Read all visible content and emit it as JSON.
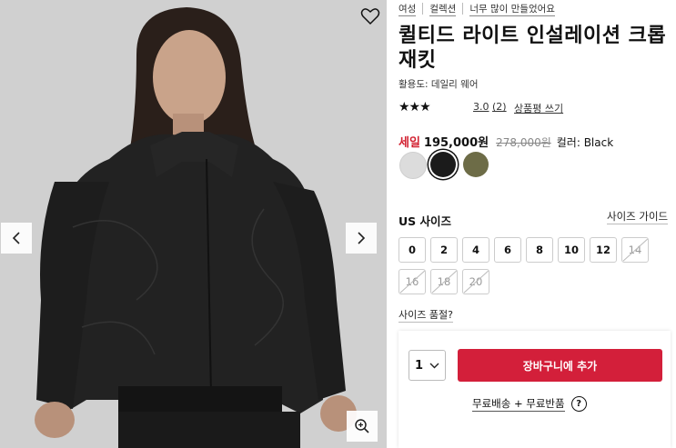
{
  "gallery": {
    "wishlist_icon": "heart-outline-icon",
    "prev_icon": "chevron-left-icon",
    "next_icon": "chevron-right-icon",
    "zoom_icon": "zoom-in-icon"
  },
  "breadcrumbs": [
    "여성",
    "컬렉션",
    "너무 많이 만들었어요"
  ],
  "product": {
    "title": "퀼티드 라이트 인설레이션 크롭 재킷",
    "activity": "활용도: 데일리 웨어",
    "rating_stars": "★★★",
    "rating_score": "3.0",
    "review_count": "(2)",
    "write_review": "상품평 쓰기"
  },
  "price": {
    "sale_label": "세일",
    "current": "195,000원",
    "original": "278,000원",
    "color_label": "컬러: Black"
  },
  "colors": [
    {
      "name": "Light Grey",
      "hex": "#dcdcdc",
      "selected": false
    },
    {
      "name": "Black",
      "hex": "#1b1b1b",
      "selected": true
    },
    {
      "name": "Olive",
      "hex": "#6d6c47",
      "selected": false
    }
  ],
  "sizes": {
    "label": "US 사이즈",
    "guide": "사이즈 가이드",
    "options": [
      {
        "label": "0",
        "available": true
      },
      {
        "label": "2",
        "available": true
      },
      {
        "label": "4",
        "available": true
      },
      {
        "label": "6",
        "available": true
      },
      {
        "label": "8",
        "available": true
      },
      {
        "label": "10",
        "available": true
      },
      {
        "label": "12",
        "available": true
      },
      {
        "label": "14",
        "available": false
      },
      {
        "label": "16",
        "available": false
      },
      {
        "label": "18",
        "available": false
      },
      {
        "label": "20",
        "available": false
      }
    ],
    "sold_out_link": "사이즈 품절?"
  },
  "cart": {
    "quantity": "1",
    "add_button": "장바구니에 추가",
    "shipping_text": "무료배송 + 무료반품",
    "help_icon": "?"
  },
  "accent_color": "#d31f3a"
}
